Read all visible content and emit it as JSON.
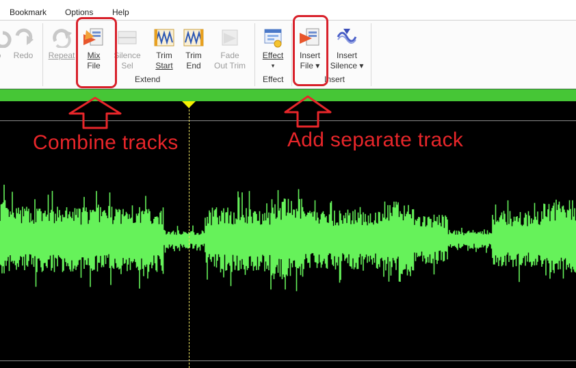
{
  "menu": {
    "items": [
      {
        "label": "Bookmark"
      },
      {
        "label": "Options"
      },
      {
        "label": "Help"
      }
    ]
  },
  "ribbon": {
    "buttons": [
      {
        "id": "partial",
        "line1": "o",
        "line2": "",
        "enabled": false
      },
      {
        "id": "redo",
        "line1": "Redo",
        "line2": "",
        "enabled": false
      },
      {
        "id": "repeat",
        "line1": "Repeat",
        "line2": "",
        "enabled": false
      },
      {
        "id": "mix-file",
        "line1": "Mix",
        "line2": "File",
        "enabled": true
      },
      {
        "id": "silence-sel",
        "line1": "Silence",
        "line2": "Sel",
        "enabled": false
      },
      {
        "id": "trim-start",
        "line1": "Trim",
        "line2": "Start",
        "enabled": true
      },
      {
        "id": "trim-end",
        "line1": "Trim",
        "line2": "End",
        "enabled": true
      },
      {
        "id": "fade-out-trim",
        "line1": "Fade",
        "line2": "Out Trim",
        "enabled": false
      },
      {
        "id": "effect",
        "line1": "Effect",
        "line2": "▾",
        "enabled": true
      },
      {
        "id": "insert-file",
        "line1": "Insert",
        "line2": "File ▾",
        "enabled": true
      },
      {
        "id": "insert-silence",
        "line1": "Insert",
        "line2": "Silence ▾",
        "enabled": true
      }
    ],
    "groups": [
      {
        "label": "Extend"
      },
      {
        "label": "Effect"
      },
      {
        "label": "Insert"
      }
    ]
  },
  "annotations": {
    "combine": "Combine tracks",
    "separate": "Add separate track"
  },
  "colors": {
    "waveform": "#66f25a",
    "timeline": "#46c636",
    "highlight": "#d8202a",
    "annotation_text": "#e8262a",
    "cursor": "#f4f000"
  }
}
